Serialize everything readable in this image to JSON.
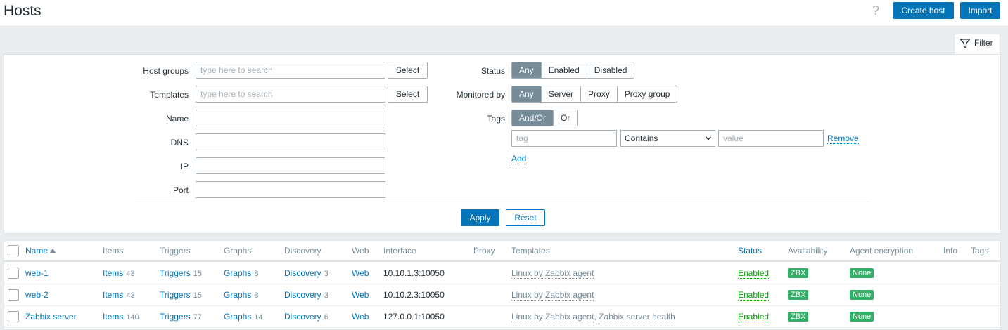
{
  "header": {
    "title": "Hosts",
    "help_glyph": "?",
    "create_host": "Create host",
    "import": "Import"
  },
  "filter": {
    "tab_label": "Filter",
    "host_groups_label": "Host groups",
    "host_groups_placeholder": "type here to search",
    "templates_label": "Templates",
    "templates_placeholder": "type here to search",
    "select_label": "Select",
    "name_label": "Name",
    "dns_label": "DNS",
    "ip_label": "IP",
    "port_label": "Port",
    "status_label": "Status",
    "status_options": [
      "Any",
      "Enabled",
      "Disabled"
    ],
    "status_selected": "Any",
    "monitored_by_label": "Monitored by",
    "monitored_by_options": [
      "Any",
      "Server",
      "Proxy",
      "Proxy group"
    ],
    "monitored_by_selected": "Any",
    "tags_label": "Tags",
    "tags_options": [
      "And/Or",
      "Or"
    ],
    "tags_selected": "And/Or",
    "tag_placeholder": "tag",
    "tag_operator": "Contains",
    "value_placeholder": "value",
    "remove_label": "Remove",
    "add_label": "Add",
    "apply_label": "Apply",
    "reset_label": "Reset"
  },
  "table": {
    "columns": [
      "Name",
      "Items",
      "Triggers",
      "Graphs",
      "Discovery",
      "Web",
      "Interface",
      "Proxy",
      "Templates",
      "Status",
      "Availability",
      "Agent encryption",
      "Info",
      "Tags"
    ],
    "sorted_column": "Name",
    "sort_direction": "ascending",
    "rows": [
      {
        "name": "web-1",
        "items_label": "Items",
        "items_count": "43",
        "triggers_label": "Triggers",
        "triggers_count": "15",
        "graphs_label": "Graphs",
        "graphs_count": "8",
        "discovery_label": "Discovery",
        "discovery_count": "3",
        "web": "Web",
        "interface": "10.10.1.3:10050",
        "proxy": "",
        "templates": [
          "Linux by Zabbix agent"
        ],
        "status": "Enabled",
        "availability": "ZBX",
        "encryption": "None"
      },
      {
        "name": "web-2",
        "items_label": "Items",
        "items_count": "43",
        "triggers_label": "Triggers",
        "triggers_count": "15",
        "graphs_label": "Graphs",
        "graphs_count": "8",
        "discovery_label": "Discovery",
        "discovery_count": "3",
        "web": "Web",
        "interface": "10.10.2.3:10050",
        "proxy": "",
        "templates": [
          "Linux by Zabbix agent"
        ],
        "status": "Enabled",
        "availability": "ZBX",
        "encryption": "None"
      },
      {
        "name": "Zabbix server",
        "items_label": "Items",
        "items_count": "140",
        "triggers_label": "Triggers",
        "triggers_count": "77",
        "graphs_label": "Graphs",
        "graphs_count": "14",
        "discovery_label": "Discovery",
        "discovery_count": "6",
        "web": "Web",
        "interface": "127.0.0.1:10050",
        "proxy": "",
        "templates": [
          "Linux by Zabbix agent",
          "Zabbix server health"
        ],
        "template_separator": ", ",
        "status": "Enabled",
        "availability": "ZBX",
        "encryption": "None"
      }
    ]
  },
  "colors": {
    "accent": "#0275b8",
    "status_enabled": "#0a9d0a",
    "badge_green": "#34af67",
    "segment_active": "#768d99"
  },
  "icons": {
    "filter": "funnel-icon",
    "help": "question-mark-icon",
    "sort": "sort-ascending-icon",
    "dropdown": "chevron-down-icon"
  }
}
